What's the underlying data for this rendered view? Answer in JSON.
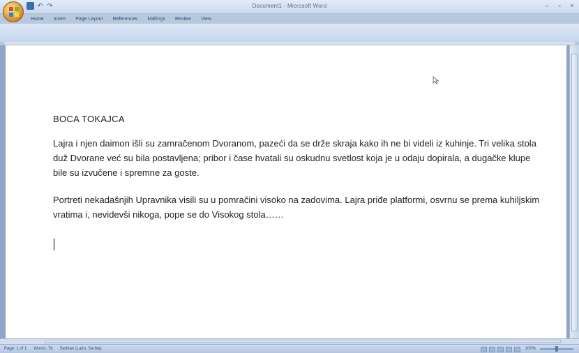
{
  "window": {
    "title": "Document1 - Microsoft Word",
    "controls": {
      "minimize": "–",
      "maximize": "▫",
      "close": "×"
    }
  },
  "quick_access": {
    "save_icon": "save-icon",
    "undo_label": "↶",
    "redo_label": "↷"
  },
  "tabs": [
    "Home",
    "Insert",
    "Page Layout",
    "References",
    "Mailings",
    "Review",
    "View"
  ],
  "document": {
    "heading": "BOCA TOKAJCA",
    "paragraphs": [
      "Lajra i njen daimon išli su zamračenom Dvoranom, pazeći da se drže skraja kako ih ne bi videli iz kuhinje. Tri velika stola duž Dvorane već su bila postavljena; pribor i čase hvatali su oskudnu svetlost koja je u odaju dopirala, a dugačke klupe bile su izvučene i spremne za goste.",
      "Portreti nekadašnjih Upravnika visili su u pomračini visoko na zadovima. Lajra priđe platformi, osvrnu se prema kuhiljskim vratima i, nevidevši nikoga, pope se do Visokog stola……"
    ]
  },
  "statusbar": {
    "page": "Page: 1 of 1",
    "words": "Words: 78",
    "language": "Serbian (Latin, Serbia)",
    "zoom": "100%",
    "zoom_level": 0.5
  },
  "colors": {
    "ribbon": "#c4d5ec",
    "page_background": "#ffffff",
    "document_area": "#8ea6c6"
  }
}
